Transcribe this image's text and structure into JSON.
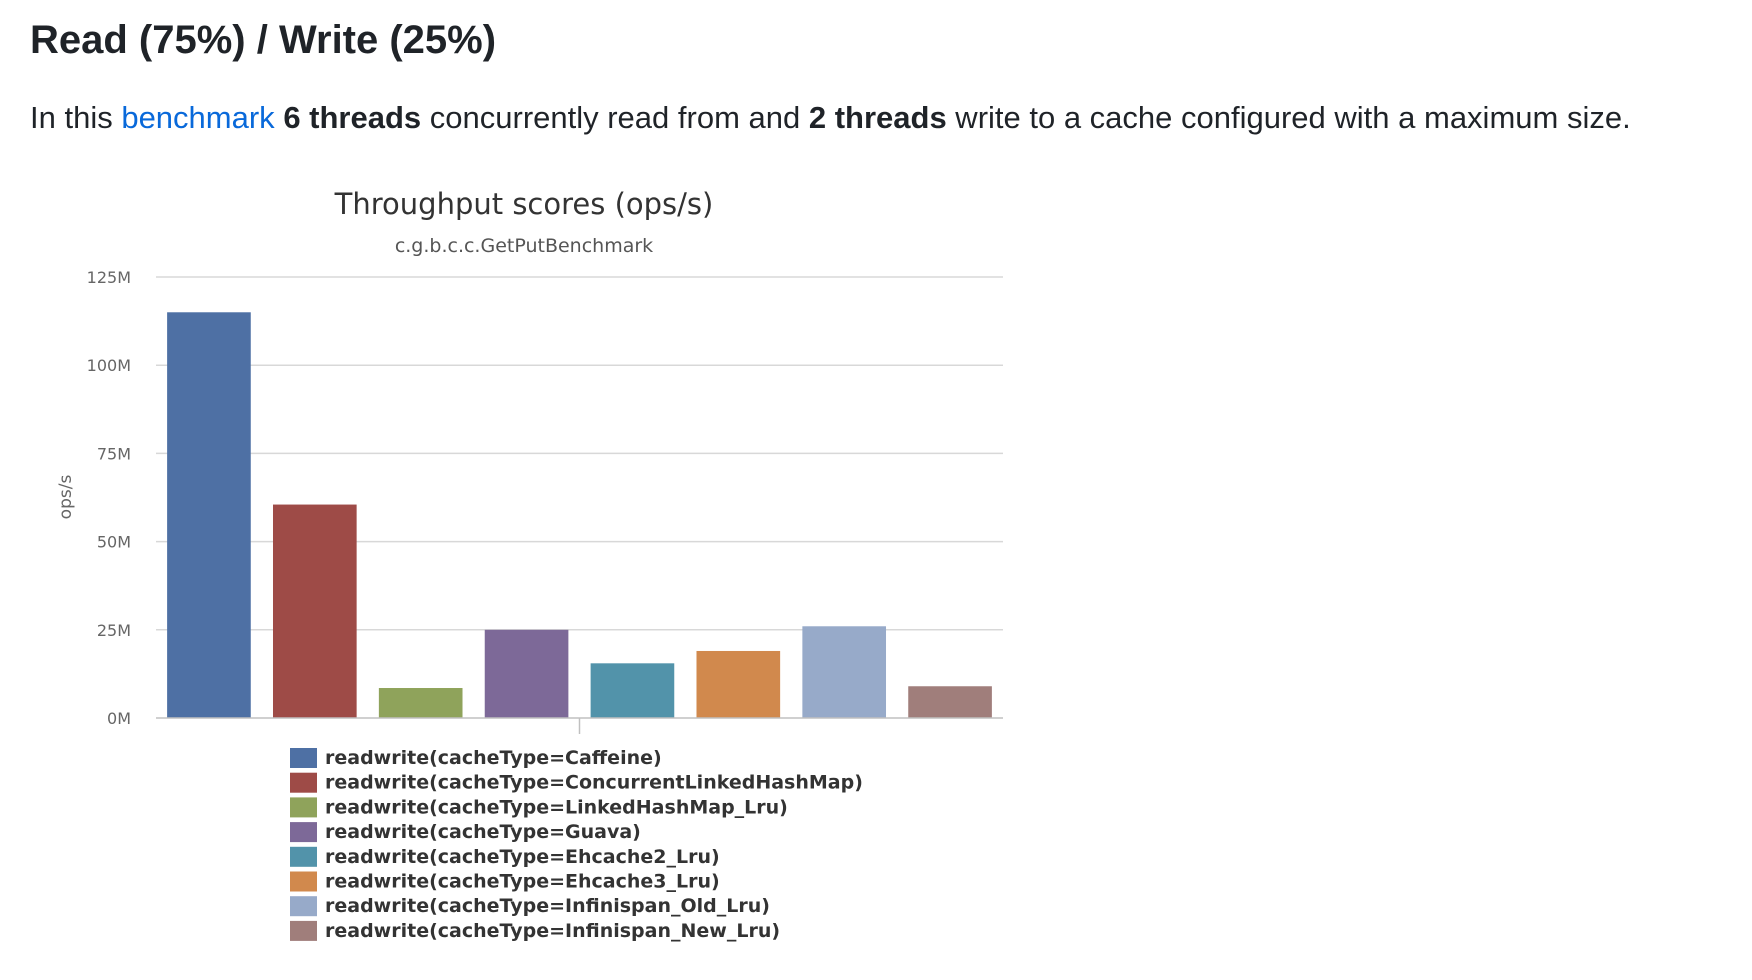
{
  "heading": "Read (75%) / Write (25%)",
  "intro": {
    "prefix": "In this ",
    "link_text": "benchmark",
    "space_1": " ",
    "readers_bold": "6 threads",
    "middle": " concurrently read from and ",
    "writers_bold": "2 threads",
    "suffix": " write to a cache configured with a maximum size."
  },
  "colors": {
    "link": "#0969da",
    "text": "#1f2328",
    "grid": "#d8d8d8"
  },
  "chart_data": {
    "type": "bar",
    "title": "Throughput scores (ops/s)",
    "subtitle": "c.g.b.c.c.GetPutBenchmark",
    "xlabel": "",
    "ylabel": "ops/s",
    "ylim": [
      0,
      125000000
    ],
    "yticks": [
      "0M",
      "25M",
      "50M",
      "75M",
      "100M",
      "125M"
    ],
    "grid": true,
    "legend_position": "bottom",
    "series": [
      {
        "name": "readwrite(cacheType=Caffeine)",
        "value": 115000000,
        "color": "#4e70a4"
      },
      {
        "name": "readwrite(cacheType=ConcurrentLinkedHashMap)",
        "value": 60500000,
        "color": "#9e4b47"
      },
      {
        "name": "readwrite(cacheType=LinkedHashMap_Lru)",
        "value": 8500000,
        "color": "#8fa35b"
      },
      {
        "name": "readwrite(cacheType=Guava)",
        "value": 25000000,
        "color": "#7d6998"
      },
      {
        "name": "readwrite(cacheType=Ehcache2_Lru)",
        "value": 15500000,
        "color": "#5293aa"
      },
      {
        "name": "readwrite(cacheType=Ehcache3_Lru)",
        "value": 19000000,
        "color": "#d1894d"
      },
      {
        "name": "readwrite(cacheType=Infinispan_Old_Lru)",
        "value": 26000000,
        "color": "#97aac9"
      },
      {
        "name": "readwrite(cacheType=Infinispan_New_Lru)",
        "value": 9000000,
        "color": "#a07e7b"
      }
    ]
  }
}
